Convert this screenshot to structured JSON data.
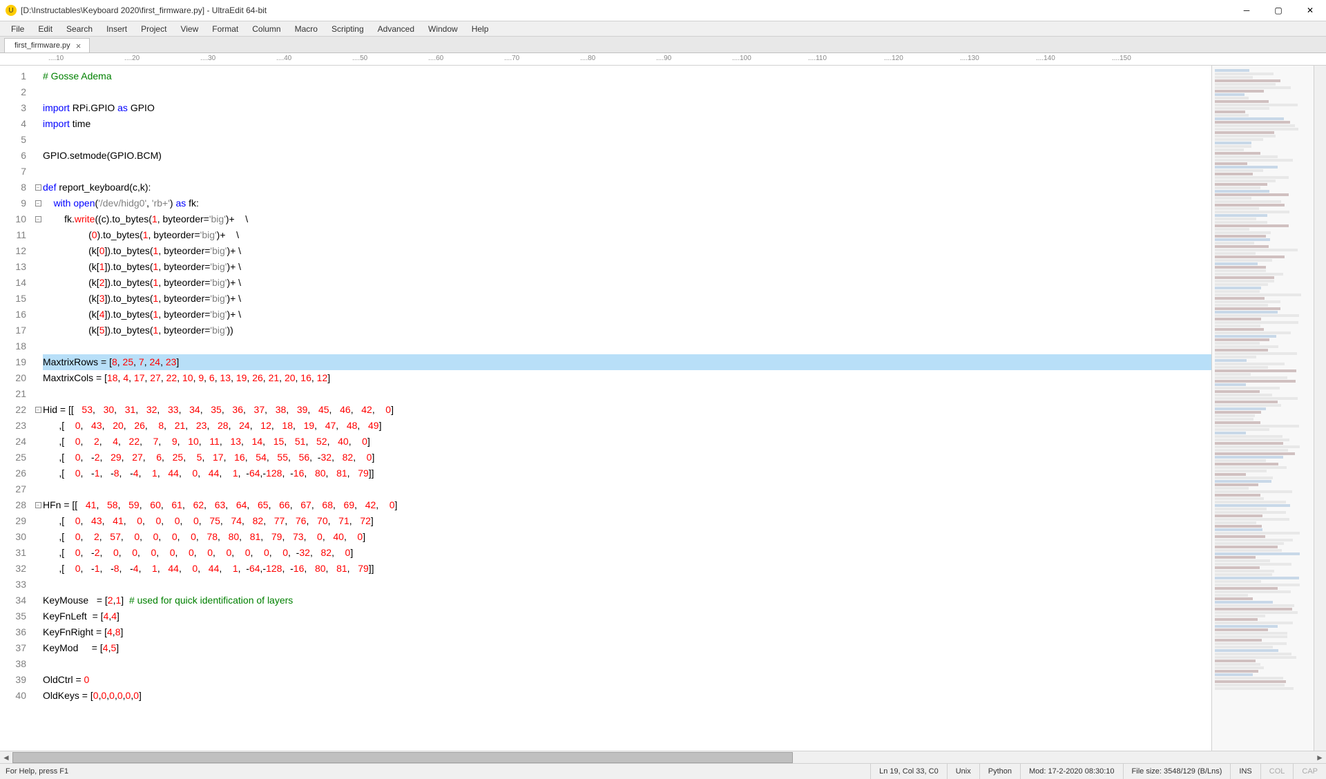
{
  "window": {
    "title": "[D:\\Instructables\\Keyboard 2020\\first_firmware.py] - UltraEdit 64-bit",
    "icon_glyph": "U"
  },
  "menu": [
    "File",
    "Edit",
    "Search",
    "Insert",
    "Project",
    "View",
    "Format",
    "Column",
    "Macro",
    "Scripting",
    "Advanced",
    "Window",
    "Help"
  ],
  "tab": {
    "label": "first_firmware.py",
    "close": "×"
  },
  "ruler_marks": [
    {
      "pos": 70,
      "label": "10"
    },
    {
      "pos": 180,
      "label": "20"
    },
    {
      "pos": 290,
      "label": "30"
    },
    {
      "pos": 400,
      "label": "40"
    },
    {
      "pos": 510,
      "label": "50"
    },
    {
      "pos": 620,
      "label": "60"
    },
    {
      "pos": 730,
      "label": "70"
    },
    {
      "pos": 840,
      "label": "80"
    },
    {
      "pos": 950,
      "label": "90"
    },
    {
      "pos": 1060,
      "label": "100"
    },
    {
      "pos": 1170,
      "label": "110"
    },
    {
      "pos": 1280,
      "label": "120"
    },
    {
      "pos": 1390,
      "label": "130"
    },
    {
      "pos": 1500,
      "label": "140"
    },
    {
      "pos": 1610,
      "label": "150"
    }
  ],
  "code_lines": [
    {
      "n": 1,
      "fold": "",
      "html": "<span class='c-green'># Gosse Adema</span>"
    },
    {
      "n": 2,
      "fold": "",
      "html": ""
    },
    {
      "n": 3,
      "fold": "",
      "html": "<span class='c-blue'>import</span> RPi.GPIO <span class='c-blue'>as</span> GPIO"
    },
    {
      "n": 4,
      "fold": "",
      "html": "<span class='c-blue'>import</span> time"
    },
    {
      "n": 5,
      "fold": "",
      "html": ""
    },
    {
      "n": 6,
      "fold": "",
      "html": "GPIO.setmode(GPIO.BCM)"
    },
    {
      "n": 7,
      "fold": "",
      "html": ""
    },
    {
      "n": 8,
      "fold": "-",
      "html": "<span class='c-blue'>def</span> report_keyboard(c,k):"
    },
    {
      "n": 9,
      "fold": "-",
      "html": "    <span class='c-blue'>with</span> <span class='c-blue'>open</span>(<span class='c-gray'>'/dev/hidg0'</span>, <span class='c-gray'>'rb+'</span>) <span class='c-blue'>as</span> fk:"
    },
    {
      "n": 10,
      "fold": "-",
      "html": "        fk.<span class='c-red'>write</span>((c).to_bytes(<span class='c-red'>1</span>, byteorder=<span class='c-gray'>'big'</span>)+    \\"
    },
    {
      "n": 11,
      "fold": "",
      "html": "                 (<span class='c-red'>0</span>).to_bytes(<span class='c-red'>1</span>, byteorder=<span class='c-gray'>'big'</span>)+    \\"
    },
    {
      "n": 12,
      "fold": "",
      "html": "                 (k[<span class='c-red'>0</span>]).to_bytes(<span class='c-red'>1</span>, byteorder=<span class='c-gray'>'big'</span>)+ \\"
    },
    {
      "n": 13,
      "fold": "",
      "html": "                 (k[<span class='c-red'>1</span>]).to_bytes(<span class='c-red'>1</span>, byteorder=<span class='c-gray'>'big'</span>)+ \\"
    },
    {
      "n": 14,
      "fold": "",
      "html": "                 (k[<span class='c-red'>2</span>]).to_bytes(<span class='c-red'>1</span>, byteorder=<span class='c-gray'>'big'</span>)+ \\"
    },
    {
      "n": 15,
      "fold": "",
      "html": "                 (k[<span class='c-red'>3</span>]).to_bytes(<span class='c-red'>1</span>, byteorder=<span class='c-gray'>'big'</span>)+ \\"
    },
    {
      "n": 16,
      "fold": "",
      "html": "                 (k[<span class='c-red'>4</span>]).to_bytes(<span class='c-red'>1</span>, byteorder=<span class='c-gray'>'big'</span>)+ \\"
    },
    {
      "n": 17,
      "fold": "",
      "html": "                 (k[<span class='c-red'>5</span>]).to_bytes(<span class='c-red'>1</span>, byteorder=<span class='c-gray'>'big'</span>))"
    },
    {
      "n": 18,
      "fold": "",
      "html": ""
    },
    {
      "n": 19,
      "fold": "",
      "hl": true,
      "html": "MaxtrixRows = [<span class='c-red'>8</span>, <span class='c-red'>25</span>, <span class='c-red'>7</span>, <span class='c-red'>24</span>, <span class='c-red'>23</span>]"
    },
    {
      "n": 20,
      "fold": "",
      "html": "MaxtrixCols = [<span class='c-red'>18</span>, <span class='c-red'>4</span>, <span class='c-red'>17</span>, <span class='c-red'>27</span>, <span class='c-red'>22</span>, <span class='c-red'>10</span>, <span class='c-red'>9</span>, <span class='c-red'>6</span>, <span class='c-red'>13</span>, <span class='c-red'>19</span>, <span class='c-red'>26</span>, <span class='c-red'>21</span>, <span class='c-red'>20</span>, <span class='c-red'>16</span>, <span class='c-red'>12</span>]"
    },
    {
      "n": 21,
      "fold": "",
      "html": ""
    },
    {
      "n": 22,
      "fold": "-",
      "html": "Hid = [[   <span class='c-red'>53</span>,   <span class='c-red'>30</span>,   <span class='c-red'>31</span>,   <span class='c-red'>32</span>,   <span class='c-red'>33</span>,   <span class='c-red'>34</span>,   <span class='c-red'>35</span>,   <span class='c-red'>36</span>,   <span class='c-red'>37</span>,   <span class='c-red'>38</span>,   <span class='c-red'>39</span>,   <span class='c-red'>45</span>,   <span class='c-red'>46</span>,   <span class='c-red'>42</span>,    <span class='c-red'>0</span>]"
    },
    {
      "n": 23,
      "fold": "",
      "html": "      ,[    <span class='c-red'>0</span>,   <span class='c-red'>43</span>,   <span class='c-red'>20</span>,   <span class='c-red'>26</span>,    <span class='c-red'>8</span>,   <span class='c-red'>21</span>,   <span class='c-red'>23</span>,   <span class='c-red'>28</span>,   <span class='c-red'>24</span>,   <span class='c-red'>12</span>,   <span class='c-red'>18</span>,   <span class='c-red'>19</span>,   <span class='c-red'>47</span>,   <span class='c-red'>48</span>,   <span class='c-red'>49</span>]"
    },
    {
      "n": 24,
      "fold": "",
      "html": "      ,[    <span class='c-red'>0</span>,    <span class='c-red'>2</span>,    <span class='c-red'>4</span>,   <span class='c-red'>22</span>,    <span class='c-red'>7</span>,    <span class='c-red'>9</span>,   <span class='c-red'>10</span>,   <span class='c-red'>11</span>,   <span class='c-red'>13</span>,   <span class='c-red'>14</span>,   <span class='c-red'>15</span>,   <span class='c-red'>51</span>,   <span class='c-red'>52</span>,   <span class='c-red'>40</span>,    <span class='c-red'>0</span>]"
    },
    {
      "n": 25,
      "fold": "",
      "html": "      ,[    <span class='c-red'>0</span>,   -<span class='c-red'>2</span>,   <span class='c-red'>29</span>,   <span class='c-red'>27</span>,    <span class='c-red'>6</span>,   <span class='c-red'>25</span>,    <span class='c-red'>5</span>,   <span class='c-red'>17</span>,   <span class='c-red'>16</span>,   <span class='c-red'>54</span>,   <span class='c-red'>55</span>,   <span class='c-red'>56</span>,  -<span class='c-red'>32</span>,   <span class='c-red'>82</span>,    <span class='c-red'>0</span>]"
    },
    {
      "n": 26,
      "fold": "",
      "html": "      ,[    <span class='c-red'>0</span>,   -<span class='c-red'>1</span>,   -<span class='c-red'>8</span>,   -<span class='c-red'>4</span>,    <span class='c-red'>1</span>,   <span class='c-red'>44</span>,    <span class='c-red'>0</span>,   <span class='c-red'>44</span>,    <span class='c-red'>1</span>,  -<span class='c-red'>64</span>,-<span class='c-red'>128</span>,  -<span class='c-red'>16</span>,   <span class='c-red'>80</span>,   <span class='c-red'>81</span>,   <span class='c-red'>79</span>]]"
    },
    {
      "n": 27,
      "fold": "",
      "html": ""
    },
    {
      "n": 28,
      "fold": "-",
      "html": "HFn = [[   <span class='c-red'>41</span>,   <span class='c-red'>58</span>,   <span class='c-red'>59</span>,   <span class='c-red'>60</span>,   <span class='c-red'>61</span>,   <span class='c-red'>62</span>,   <span class='c-red'>63</span>,   <span class='c-red'>64</span>,   <span class='c-red'>65</span>,   <span class='c-red'>66</span>,   <span class='c-red'>67</span>,   <span class='c-red'>68</span>,   <span class='c-red'>69</span>,   <span class='c-red'>42</span>,    <span class='c-red'>0</span>]"
    },
    {
      "n": 29,
      "fold": "",
      "html": "      ,[    <span class='c-red'>0</span>,   <span class='c-red'>43</span>,   <span class='c-red'>41</span>,    <span class='c-red'>0</span>,    <span class='c-red'>0</span>,    <span class='c-red'>0</span>,    <span class='c-red'>0</span>,   <span class='c-red'>75</span>,   <span class='c-red'>74</span>,   <span class='c-red'>82</span>,   <span class='c-red'>77</span>,   <span class='c-red'>76</span>,   <span class='c-red'>70</span>,   <span class='c-red'>71</span>,   <span class='c-red'>72</span>]"
    },
    {
      "n": 30,
      "fold": "",
      "html": "      ,[    <span class='c-red'>0</span>,    <span class='c-red'>2</span>,   <span class='c-red'>57</span>,    <span class='c-red'>0</span>,    <span class='c-red'>0</span>,    <span class='c-red'>0</span>,    <span class='c-red'>0</span>,   <span class='c-red'>78</span>,   <span class='c-red'>80</span>,   <span class='c-red'>81</span>,   <span class='c-red'>79</span>,   <span class='c-red'>73</span>,    <span class='c-red'>0</span>,   <span class='c-red'>40</span>,    <span class='c-red'>0</span>]"
    },
    {
      "n": 31,
      "fold": "",
      "html": "      ,[    <span class='c-red'>0</span>,   -<span class='c-red'>2</span>,    <span class='c-red'>0</span>,    <span class='c-red'>0</span>,    <span class='c-red'>0</span>,    <span class='c-red'>0</span>,    <span class='c-red'>0</span>,    <span class='c-red'>0</span>,    <span class='c-red'>0</span>,    <span class='c-red'>0</span>,    <span class='c-red'>0</span>,    <span class='c-red'>0</span>,  -<span class='c-red'>32</span>,   <span class='c-red'>82</span>,    <span class='c-red'>0</span>]"
    },
    {
      "n": 32,
      "fold": "",
      "html": "      ,[    <span class='c-red'>0</span>,   -<span class='c-red'>1</span>,   -<span class='c-red'>8</span>,   -<span class='c-red'>4</span>,    <span class='c-red'>1</span>,   <span class='c-red'>44</span>,    <span class='c-red'>0</span>,   <span class='c-red'>44</span>,    <span class='c-red'>1</span>,  -<span class='c-red'>64</span>,-<span class='c-red'>128</span>,  -<span class='c-red'>16</span>,   <span class='c-red'>80</span>,   <span class='c-red'>81</span>,   <span class='c-red'>79</span>]]"
    },
    {
      "n": 33,
      "fold": "",
      "html": ""
    },
    {
      "n": 34,
      "fold": "",
      "html": "KeyMouse   = [<span class='c-red'>2</span>,<span class='c-red'>1</span>]  <span class='c-green'># used for quick identification of layers</span>"
    },
    {
      "n": 35,
      "fold": "",
      "html": "KeyFnLeft  = [<span class='c-red'>4</span>,<span class='c-red'>4</span>]"
    },
    {
      "n": 36,
      "fold": "",
      "html": "KeyFnRight = [<span class='c-red'>4</span>,<span class='c-red'>8</span>]"
    },
    {
      "n": 37,
      "fold": "",
      "html": "KeyMod     = [<span class='c-red'>4</span>,<span class='c-red'>5</span>]"
    },
    {
      "n": 38,
      "fold": "",
      "html": ""
    },
    {
      "n": 39,
      "fold": "",
      "html": "OldCtrl = <span class='c-red'>0</span>"
    },
    {
      "n": 40,
      "fold": "",
      "html": "OldKeys = [<span class='c-red'>0</span>,<span class='c-red'>0</span>,<span class='c-red'>0</span>,<span class='c-red'>0</span>,<span class='c-red'>0</span>,<span class='c-red'>0</span>]"
    }
  ],
  "status": {
    "help": "For Help, press F1",
    "pos": "Ln 19, Col 33, C0",
    "eol": "Unix",
    "lang": "Python",
    "mod": "Mod: 17-2-2020 08:30:10",
    "size": "File size: 3548/129 (B/Lns)",
    "ins": "INS",
    "col": "COL",
    "cap": "CAP"
  }
}
